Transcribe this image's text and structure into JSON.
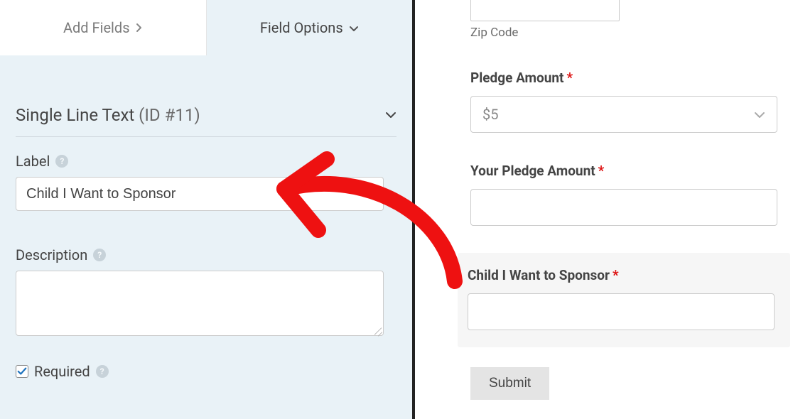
{
  "tabs": {
    "add_fields": "Add Fields",
    "field_options": "Field Options"
  },
  "field_header": {
    "title": "Single Line Text",
    "id_text": "(ID #11)"
  },
  "options": {
    "label_caption": "Label",
    "label_value": "Child I Want to Sponsor",
    "description_caption": "Description",
    "description_value": "",
    "required_caption": "Required",
    "required_checked": true
  },
  "preview": {
    "zip_code_label": "Zip Code",
    "pledge_amount_label": "Pledge Amount",
    "pledge_amount_value": "$5",
    "your_pledge_amount_label": "Your Pledge Amount",
    "child_field_label": "Child I Want to Sponsor",
    "submit_label": "Submit"
  }
}
